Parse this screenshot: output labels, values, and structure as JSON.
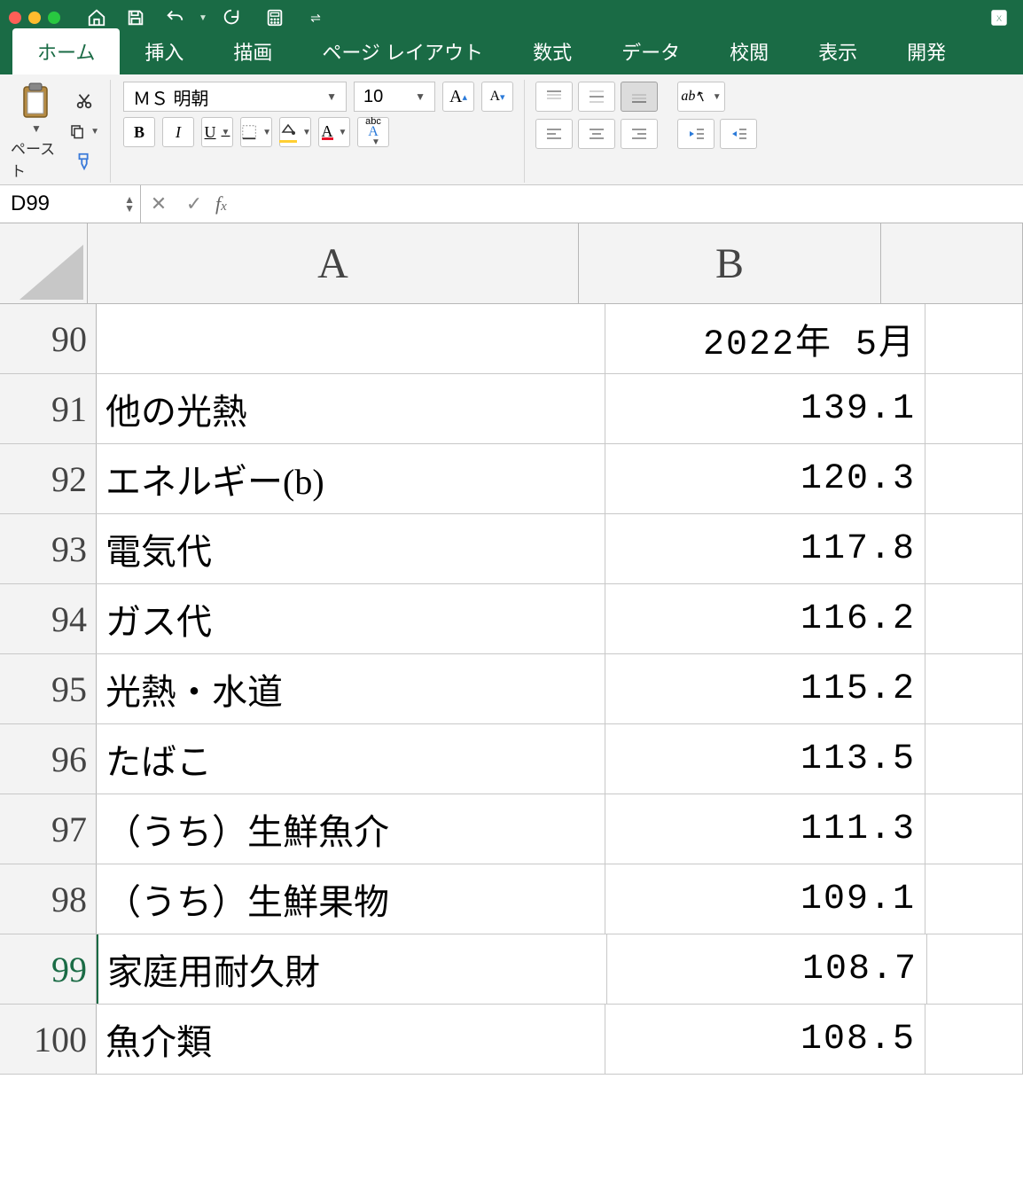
{
  "qat": {
    "home_icon": "home",
    "save_icon": "save",
    "undo_icon": "undo",
    "redo_icon": "redo",
    "calc_icon": "calculator",
    "customize": "customize"
  },
  "tabs": {
    "home": "ホーム",
    "insert": "挿入",
    "draw": "描画",
    "page_layout": "ページ レイアウト",
    "formulas": "数式",
    "data": "データ",
    "review": "校閲",
    "view": "表示",
    "developer": "開発"
  },
  "ribbon": {
    "paste_label": "ペースト",
    "font_name": "ＭＳ 明朝",
    "font_size": "10",
    "bold": "B",
    "italic": "I",
    "underline": "U",
    "abc_style": "abc",
    "increase_font": "A",
    "decrease_font": "A",
    "font_color": "A",
    "fill_color": "◇"
  },
  "namebox": {
    "value": "D99"
  },
  "formula": {
    "value": ""
  },
  "columns": {
    "a": "A",
    "b": "B"
  },
  "chart_data": {
    "type": "table",
    "title": "2022年 5月",
    "header_row": 90,
    "rows": [
      {
        "n": 90,
        "label": "",
        "value": "2022年 5月"
      },
      {
        "n": 91,
        "label": "他の光熱",
        "value": "139.1"
      },
      {
        "n": 92,
        "label": "エネルギー(b)",
        "value": "120.3"
      },
      {
        "n": 93,
        "label": "電気代",
        "value": "117.8"
      },
      {
        "n": 94,
        "label": "ガス代",
        "value": "116.2"
      },
      {
        "n": 95,
        "label": "光熱・水道",
        "value": "115.2"
      },
      {
        "n": 96,
        "label": "たばこ",
        "value": "113.5"
      },
      {
        "n": 97,
        "label": "（うち）生鮮魚介",
        "value": "111.3"
      },
      {
        "n": 98,
        "label": "（うち）生鮮果物",
        "value": "109.1"
      },
      {
        "n": 99,
        "label": "家庭用耐久財",
        "value": "108.7"
      },
      {
        "n": 100,
        "label": "魚介類",
        "value": "108.5"
      }
    ]
  }
}
